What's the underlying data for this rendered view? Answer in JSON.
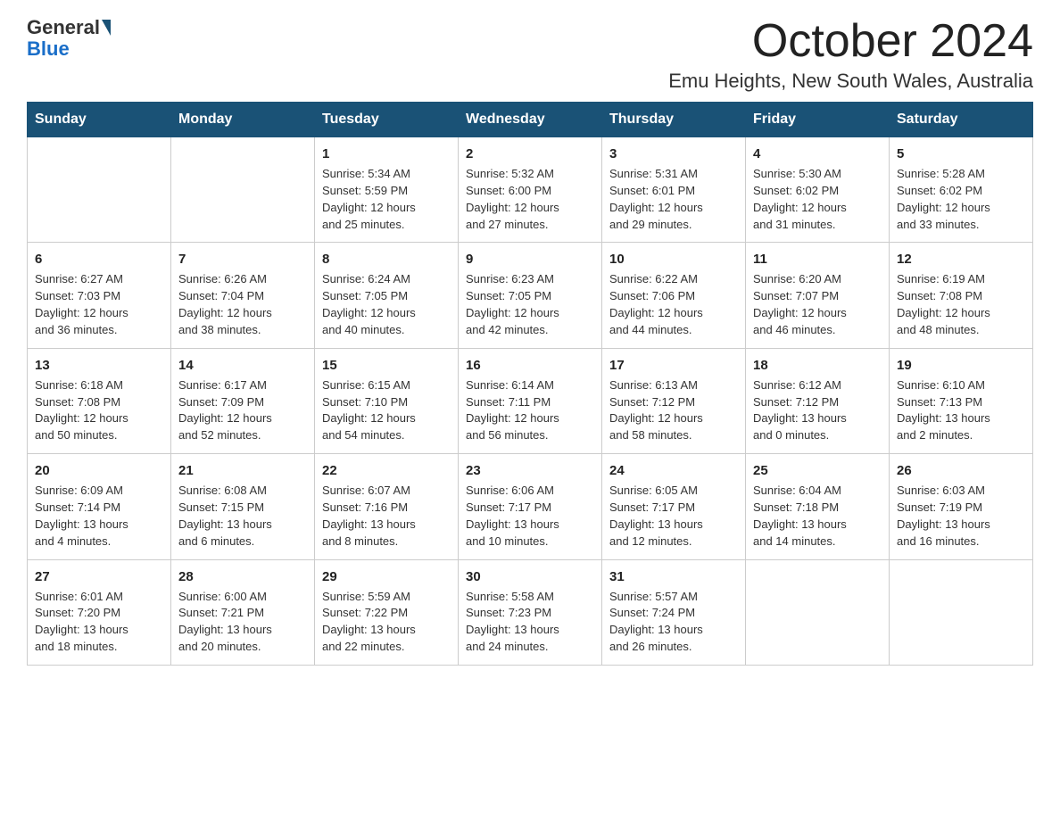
{
  "logo": {
    "general": "General",
    "blue": "Blue"
  },
  "title": "October 2024",
  "location": "Emu Heights, New South Wales, Australia",
  "days_of_week": [
    "Sunday",
    "Monday",
    "Tuesday",
    "Wednesday",
    "Thursday",
    "Friday",
    "Saturday"
  ],
  "weeks": [
    [
      {
        "day": "",
        "info": ""
      },
      {
        "day": "",
        "info": ""
      },
      {
        "day": "1",
        "info": "Sunrise: 5:34 AM\nSunset: 5:59 PM\nDaylight: 12 hours\nand 25 minutes."
      },
      {
        "day": "2",
        "info": "Sunrise: 5:32 AM\nSunset: 6:00 PM\nDaylight: 12 hours\nand 27 minutes."
      },
      {
        "day": "3",
        "info": "Sunrise: 5:31 AM\nSunset: 6:01 PM\nDaylight: 12 hours\nand 29 minutes."
      },
      {
        "day": "4",
        "info": "Sunrise: 5:30 AM\nSunset: 6:02 PM\nDaylight: 12 hours\nand 31 minutes."
      },
      {
        "day": "5",
        "info": "Sunrise: 5:28 AM\nSunset: 6:02 PM\nDaylight: 12 hours\nand 33 minutes."
      }
    ],
    [
      {
        "day": "6",
        "info": "Sunrise: 6:27 AM\nSunset: 7:03 PM\nDaylight: 12 hours\nand 36 minutes."
      },
      {
        "day": "7",
        "info": "Sunrise: 6:26 AM\nSunset: 7:04 PM\nDaylight: 12 hours\nand 38 minutes."
      },
      {
        "day": "8",
        "info": "Sunrise: 6:24 AM\nSunset: 7:05 PM\nDaylight: 12 hours\nand 40 minutes."
      },
      {
        "day": "9",
        "info": "Sunrise: 6:23 AM\nSunset: 7:05 PM\nDaylight: 12 hours\nand 42 minutes."
      },
      {
        "day": "10",
        "info": "Sunrise: 6:22 AM\nSunset: 7:06 PM\nDaylight: 12 hours\nand 44 minutes."
      },
      {
        "day": "11",
        "info": "Sunrise: 6:20 AM\nSunset: 7:07 PM\nDaylight: 12 hours\nand 46 minutes."
      },
      {
        "day": "12",
        "info": "Sunrise: 6:19 AM\nSunset: 7:08 PM\nDaylight: 12 hours\nand 48 minutes."
      }
    ],
    [
      {
        "day": "13",
        "info": "Sunrise: 6:18 AM\nSunset: 7:08 PM\nDaylight: 12 hours\nand 50 minutes."
      },
      {
        "day": "14",
        "info": "Sunrise: 6:17 AM\nSunset: 7:09 PM\nDaylight: 12 hours\nand 52 minutes."
      },
      {
        "day": "15",
        "info": "Sunrise: 6:15 AM\nSunset: 7:10 PM\nDaylight: 12 hours\nand 54 minutes."
      },
      {
        "day": "16",
        "info": "Sunrise: 6:14 AM\nSunset: 7:11 PM\nDaylight: 12 hours\nand 56 minutes."
      },
      {
        "day": "17",
        "info": "Sunrise: 6:13 AM\nSunset: 7:12 PM\nDaylight: 12 hours\nand 58 minutes."
      },
      {
        "day": "18",
        "info": "Sunrise: 6:12 AM\nSunset: 7:12 PM\nDaylight: 13 hours\nand 0 minutes."
      },
      {
        "day": "19",
        "info": "Sunrise: 6:10 AM\nSunset: 7:13 PM\nDaylight: 13 hours\nand 2 minutes."
      }
    ],
    [
      {
        "day": "20",
        "info": "Sunrise: 6:09 AM\nSunset: 7:14 PM\nDaylight: 13 hours\nand 4 minutes."
      },
      {
        "day": "21",
        "info": "Sunrise: 6:08 AM\nSunset: 7:15 PM\nDaylight: 13 hours\nand 6 minutes."
      },
      {
        "day": "22",
        "info": "Sunrise: 6:07 AM\nSunset: 7:16 PM\nDaylight: 13 hours\nand 8 minutes."
      },
      {
        "day": "23",
        "info": "Sunrise: 6:06 AM\nSunset: 7:17 PM\nDaylight: 13 hours\nand 10 minutes."
      },
      {
        "day": "24",
        "info": "Sunrise: 6:05 AM\nSunset: 7:17 PM\nDaylight: 13 hours\nand 12 minutes."
      },
      {
        "day": "25",
        "info": "Sunrise: 6:04 AM\nSunset: 7:18 PM\nDaylight: 13 hours\nand 14 minutes."
      },
      {
        "day": "26",
        "info": "Sunrise: 6:03 AM\nSunset: 7:19 PM\nDaylight: 13 hours\nand 16 minutes."
      }
    ],
    [
      {
        "day": "27",
        "info": "Sunrise: 6:01 AM\nSunset: 7:20 PM\nDaylight: 13 hours\nand 18 minutes."
      },
      {
        "day": "28",
        "info": "Sunrise: 6:00 AM\nSunset: 7:21 PM\nDaylight: 13 hours\nand 20 minutes."
      },
      {
        "day": "29",
        "info": "Sunrise: 5:59 AM\nSunset: 7:22 PM\nDaylight: 13 hours\nand 22 minutes."
      },
      {
        "day": "30",
        "info": "Sunrise: 5:58 AM\nSunset: 7:23 PM\nDaylight: 13 hours\nand 24 minutes."
      },
      {
        "day": "31",
        "info": "Sunrise: 5:57 AM\nSunset: 7:24 PM\nDaylight: 13 hours\nand 26 minutes."
      },
      {
        "day": "",
        "info": ""
      },
      {
        "day": "",
        "info": ""
      }
    ]
  ]
}
